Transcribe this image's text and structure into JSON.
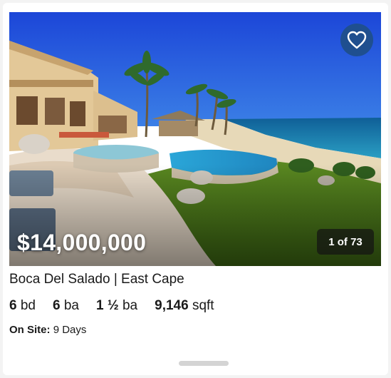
{
  "listing": {
    "price": "$14,000,000",
    "photo_counter": "1 of 73",
    "title": "Boca Del Salado | East Cape",
    "beds_value": "6",
    "beds_unit": "bd",
    "baths_value": "6",
    "baths_unit": "ba",
    "half_baths_value": "1 ½",
    "half_baths_unit": "ba",
    "sqft_value": "9,146",
    "sqft_unit": "sqft",
    "on_site_label": "On Site:",
    "on_site_value": "9 Days"
  },
  "icons": {
    "favorite": "heart-icon"
  },
  "colors": {
    "favorite_button": "#1f4f8f",
    "counter_bg": "#141414",
    "text": "#1a1a1a"
  }
}
